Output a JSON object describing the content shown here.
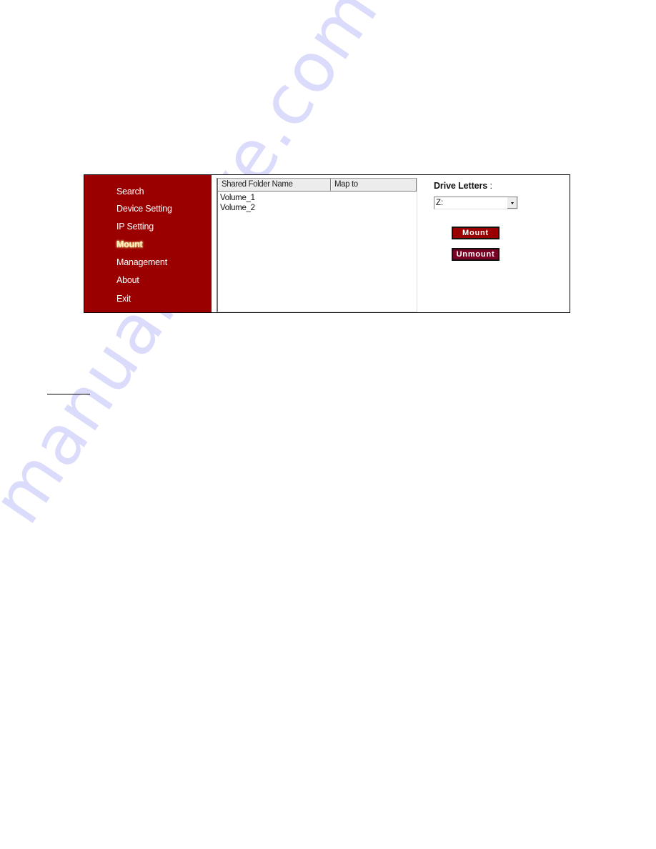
{
  "sidebar": {
    "items": [
      {
        "label": "Search",
        "active": false
      },
      {
        "label": "Device Setting",
        "active": false
      },
      {
        "label": "IP Setting",
        "active": false
      },
      {
        "label": "Mount",
        "active": true
      },
      {
        "label": "Management",
        "active": false
      },
      {
        "label": "About",
        "active": false
      },
      {
        "label": "Exit",
        "active": false
      }
    ]
  },
  "shared_folders": {
    "columns": [
      "Shared Folder Name",
      "Map to"
    ],
    "rows": [
      {
        "name": "Volume_1",
        "map_to": ""
      },
      {
        "name": "Volume_2",
        "map_to": ""
      }
    ]
  },
  "drive": {
    "label": "Drive Letters",
    "label_suffix": " :",
    "selected": "Z:"
  },
  "buttons": {
    "mount": "Mount",
    "unmount": "Unmount"
  },
  "colors": {
    "sidebar_bg": "#9b0000",
    "mount_button": "#9b0000",
    "unmount_button": "#7a0024",
    "active_item_text": "#fff4c8"
  },
  "watermark": {
    "text": "manualshive.com"
  }
}
